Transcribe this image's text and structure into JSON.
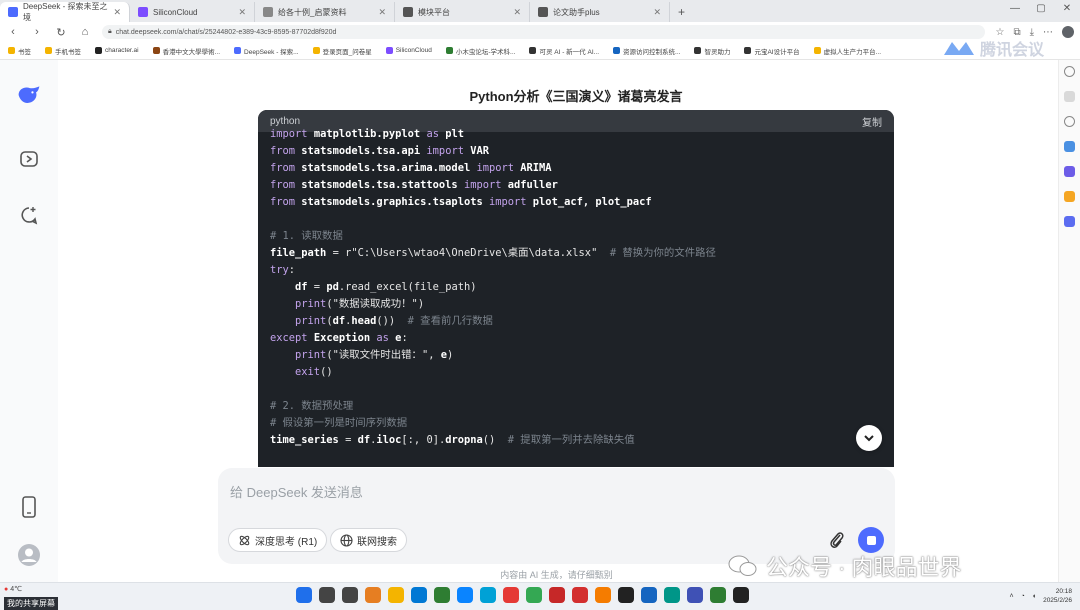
{
  "browser": {
    "tabs": [
      {
        "label": "DeepSeek - 探索未至之境",
        "favicon_color": "#4d6bfe",
        "active": true
      },
      {
        "label": "SiliconCloud",
        "favicon_color": "#7c4dff"
      },
      {
        "label": "给各十例_启蒙资料",
        "favicon_color": "#888888"
      },
      {
        "label": "模块平台",
        "favicon_color": "#555555"
      },
      {
        "label": "论文助手plus",
        "favicon_color": "#555555"
      }
    ],
    "url": "chat.deepseek.com/a/chat/s/25244802-e389-43c9-8595-87702d8f920d",
    "bookmarks": [
      {
        "label": "书签",
        "color": "#f4b400"
      },
      {
        "label": "手机书签",
        "color": "#f4b400"
      },
      {
        "label": "character.ai",
        "color": "#222222"
      },
      {
        "label": "香港中文大學學術...",
        "color": "#8b4513"
      },
      {
        "label": "DeepSeek - 探索...",
        "color": "#4d6bfe"
      },
      {
        "label": "登录页面_问卷星",
        "color": "#f4b400"
      },
      {
        "label": "SiliconCloud",
        "color": "#7c4dff"
      },
      {
        "label": "小木虫论坛-学术科...",
        "color": "#2e7d32"
      },
      {
        "label": "可灵 AI - 新一代 AI...",
        "color": "#333333"
      },
      {
        "label": "资源访问控制系统...",
        "color": "#1565c0"
      },
      {
        "label": "智灵助力",
        "color": "#333333"
      },
      {
        "label": "元宝AI设计平台",
        "color": "#333333"
      },
      {
        "label": "虚拟人生产力平台...",
        "color": "#f4b400"
      }
    ],
    "brand_watermark": "腾讯会议"
  },
  "page": {
    "title": "Python分析《三国演义》诸葛亮发言"
  },
  "code_block": {
    "language": "python",
    "copy_label": "复制",
    "lines": [
      [
        {
          "t": "import",
          "c": "kw"
        },
        {
          "t": " "
        },
        {
          "t": "matplotlib.pyplot",
          "c": "bold"
        },
        {
          "t": " "
        },
        {
          "t": "as",
          "c": "kw"
        },
        {
          "t": " "
        },
        {
          "t": "plt",
          "c": "bold"
        }
      ],
      [
        {
          "t": "from",
          "c": "kw"
        },
        {
          "t": " "
        },
        {
          "t": "statsmodels.tsa.api",
          "c": "bold"
        },
        {
          "t": " "
        },
        {
          "t": "import",
          "c": "kw"
        },
        {
          "t": " "
        },
        {
          "t": "VAR",
          "c": "bold"
        }
      ],
      [
        {
          "t": "from",
          "c": "kw"
        },
        {
          "t": " "
        },
        {
          "t": "statsmodels.tsa.arima.model",
          "c": "bold"
        },
        {
          "t": " "
        },
        {
          "t": "import",
          "c": "kw"
        },
        {
          "t": " "
        },
        {
          "t": "ARIMA",
          "c": "bold"
        }
      ],
      [
        {
          "t": "from",
          "c": "kw"
        },
        {
          "t": " "
        },
        {
          "t": "statsmodels.tsa.stattools",
          "c": "bold"
        },
        {
          "t": " "
        },
        {
          "t": "import",
          "c": "kw"
        },
        {
          "t": " "
        },
        {
          "t": "adfuller",
          "c": "bold"
        }
      ],
      [
        {
          "t": "from",
          "c": "kw"
        },
        {
          "t": " "
        },
        {
          "t": "statsmodels.graphics.tsaplots",
          "c": "bold"
        },
        {
          "t": " "
        },
        {
          "t": "import",
          "c": "kw"
        },
        {
          "t": " "
        },
        {
          "t": "plot_acf, plot_pacf",
          "c": "bold"
        }
      ],
      [],
      [
        {
          "t": "# 1. 读取数据",
          "c": "cm"
        }
      ],
      [
        {
          "t": "file_path",
          "c": "bold"
        },
        {
          "t": " = r\"C:\\Users\\wtao4\\OneDrive\\桌面\\data.xlsx\"  "
        },
        {
          "t": "# 替换为你的文件路径",
          "c": "cm"
        }
      ],
      [
        {
          "t": "try",
          "c": "kw"
        },
        {
          "t": ":"
        }
      ],
      [
        {
          "t": "    "
        },
        {
          "t": "df",
          "c": "bold"
        },
        {
          "t": " = "
        },
        {
          "t": "pd",
          "c": "bold"
        },
        {
          "t": ".read_excel(file_path)"
        }
      ],
      [
        {
          "t": "    "
        },
        {
          "t": "print",
          "c": "kw"
        },
        {
          "t": "(\"数据读取成功！\")"
        }
      ],
      [
        {
          "t": "    "
        },
        {
          "t": "print",
          "c": "kw"
        },
        {
          "t": "("
        },
        {
          "t": "df",
          "c": "bold"
        },
        {
          "t": "."
        },
        {
          "t": "head",
          "c": "bold"
        },
        {
          "t": "())  "
        },
        {
          "t": "# 查看前几行数据",
          "c": "cm"
        }
      ],
      [
        {
          "t": "except",
          "c": "kw"
        },
        {
          "t": " "
        },
        {
          "t": "Exception",
          "c": "bold"
        },
        {
          "t": " "
        },
        {
          "t": "as",
          "c": "kw"
        },
        {
          "t": " "
        },
        {
          "t": "e",
          "c": "bold"
        },
        {
          "t": ":"
        }
      ],
      [
        {
          "t": "    "
        },
        {
          "t": "print",
          "c": "kw"
        },
        {
          "t": "(\"读取文件时出错：\", "
        },
        {
          "t": "e",
          "c": "bold"
        },
        {
          "t": ")"
        }
      ],
      [
        {
          "t": "    "
        },
        {
          "t": "exit",
          "c": "kw"
        },
        {
          "t": "()"
        }
      ],
      [],
      [
        {
          "t": "# 2. 数据预处理",
          "c": "cm"
        }
      ],
      [
        {
          "t": "# 假设第一列是时间序列数据",
          "c": "cm"
        }
      ],
      [
        {
          "t": "time_series",
          "c": "bold"
        },
        {
          "t": " = "
        },
        {
          "t": "df",
          "c": "bold"
        },
        {
          "t": "."
        },
        {
          "t": "iloc",
          "c": "bold"
        },
        {
          "t": "[:, 0]."
        },
        {
          "t": "dropna",
          "c": "bold"
        },
        {
          "t": "()  "
        },
        {
          "t": "# 提取第一列并去除缺失值",
          "c": "cm"
        }
      ]
    ]
  },
  "composer": {
    "placeholder": "给 DeepSeek 发送消息",
    "deep_think_label": "深度思考 (R1)",
    "web_search_label": "联网搜索"
  },
  "disclaimer": "内容由 AI 生成，请仔细甄别",
  "watermark": "公众号 · 肉眼品世界",
  "taskbar": {
    "share_label": "我的共享屏幕",
    "left_status": "4℃",
    "time": "20:18",
    "date": "2025/2/26",
    "app_colors": [
      "#1f6feb",
      "#444",
      "#444",
      "#e67e22",
      "#f4b400",
      "#0078d4",
      "#2e7d32",
      "#0a84ff",
      "#00a1d6",
      "#e53935",
      "#34a853",
      "#c62828",
      "#d32f2f",
      "#f57c00",
      "#222",
      "#1565c0",
      "#009688",
      "#3f51b5",
      "#2e7d32",
      "#222"
    ]
  },
  "colors": {
    "accent": "#4d6bfe",
    "code_bg": "#1e2227",
    "code_header": "#363a40"
  }
}
